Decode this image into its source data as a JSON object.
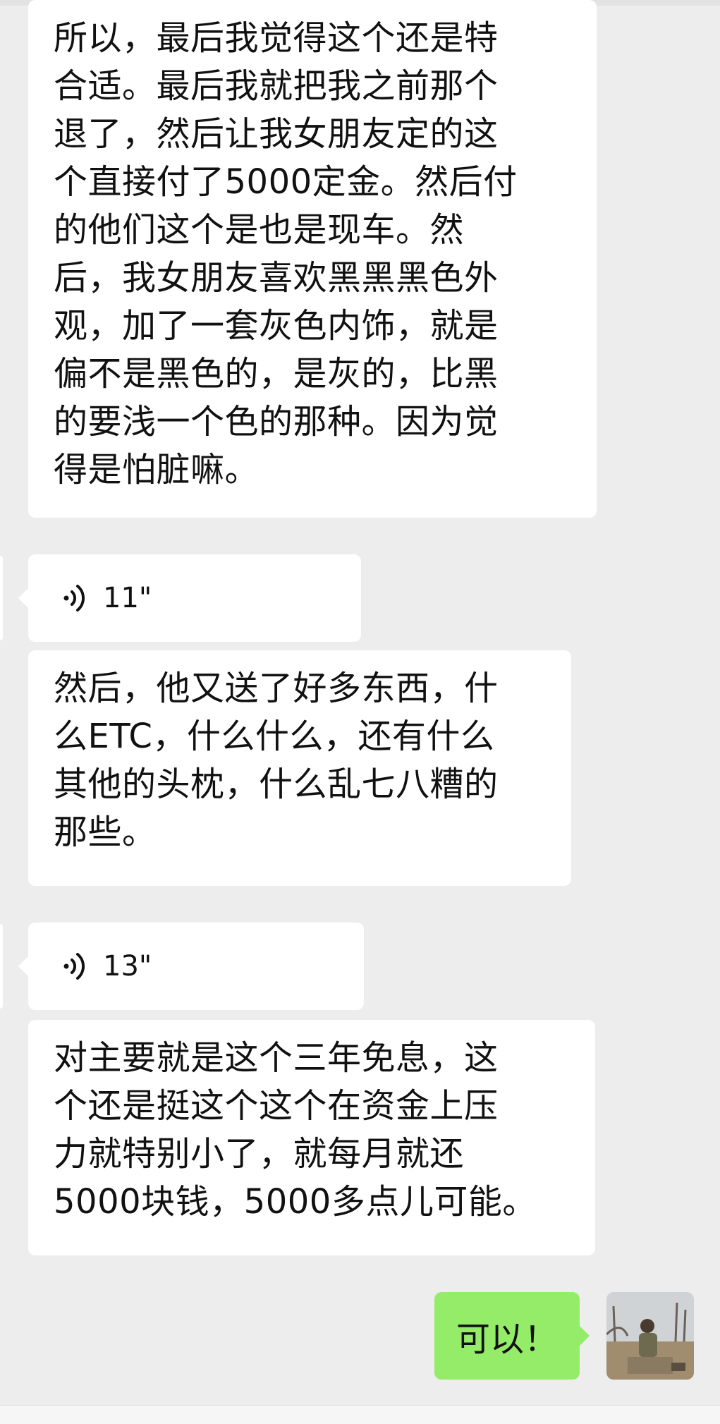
{
  "messages": [
    {
      "type": "text",
      "side": "left",
      "lines": [
        "所以，最后我觉得这个还是特",
        "合适。最后我就把我之前那个",
        "退了，然后让我女朋友定的这",
        "个直接付了5000定金。然后付",
        "的他们这个是也是现车。然",
        "后，我女朋友喜欢黑黑黑色外",
        "观，加了一套灰色内饰，就是",
        "偏不是黑色的，是灰的，比黑",
        "的要浅一个色的那种。因为觉",
        "得是怕脏嘛。"
      ]
    },
    {
      "type": "voice",
      "side": "left",
      "duration": "11\"",
      "icon": "voice-wave-icon"
    },
    {
      "type": "text",
      "side": "left",
      "lines": [
        "然后，他又送了好多东西，什",
        "么ETC，什么什么，还有什么",
        "其他的头枕，什么乱七八糟的",
        "那些。"
      ]
    },
    {
      "type": "voice",
      "side": "left",
      "duration": "13\"",
      "icon": "voice-wave-icon"
    },
    {
      "type": "text",
      "side": "left",
      "lines": [
        "对主要就是这个三年免息，这",
        "个还是挺这个这个在资金上压",
        "力就特别小了，就每月就还",
        "5000块钱，5000多点儿可能。"
      ]
    },
    {
      "type": "text",
      "side": "right",
      "text": "可以！"
    }
  ],
  "colors": {
    "background": "#ededed",
    "received_bubble": "#ffffff",
    "sent_bubble": "#95ec69"
  }
}
